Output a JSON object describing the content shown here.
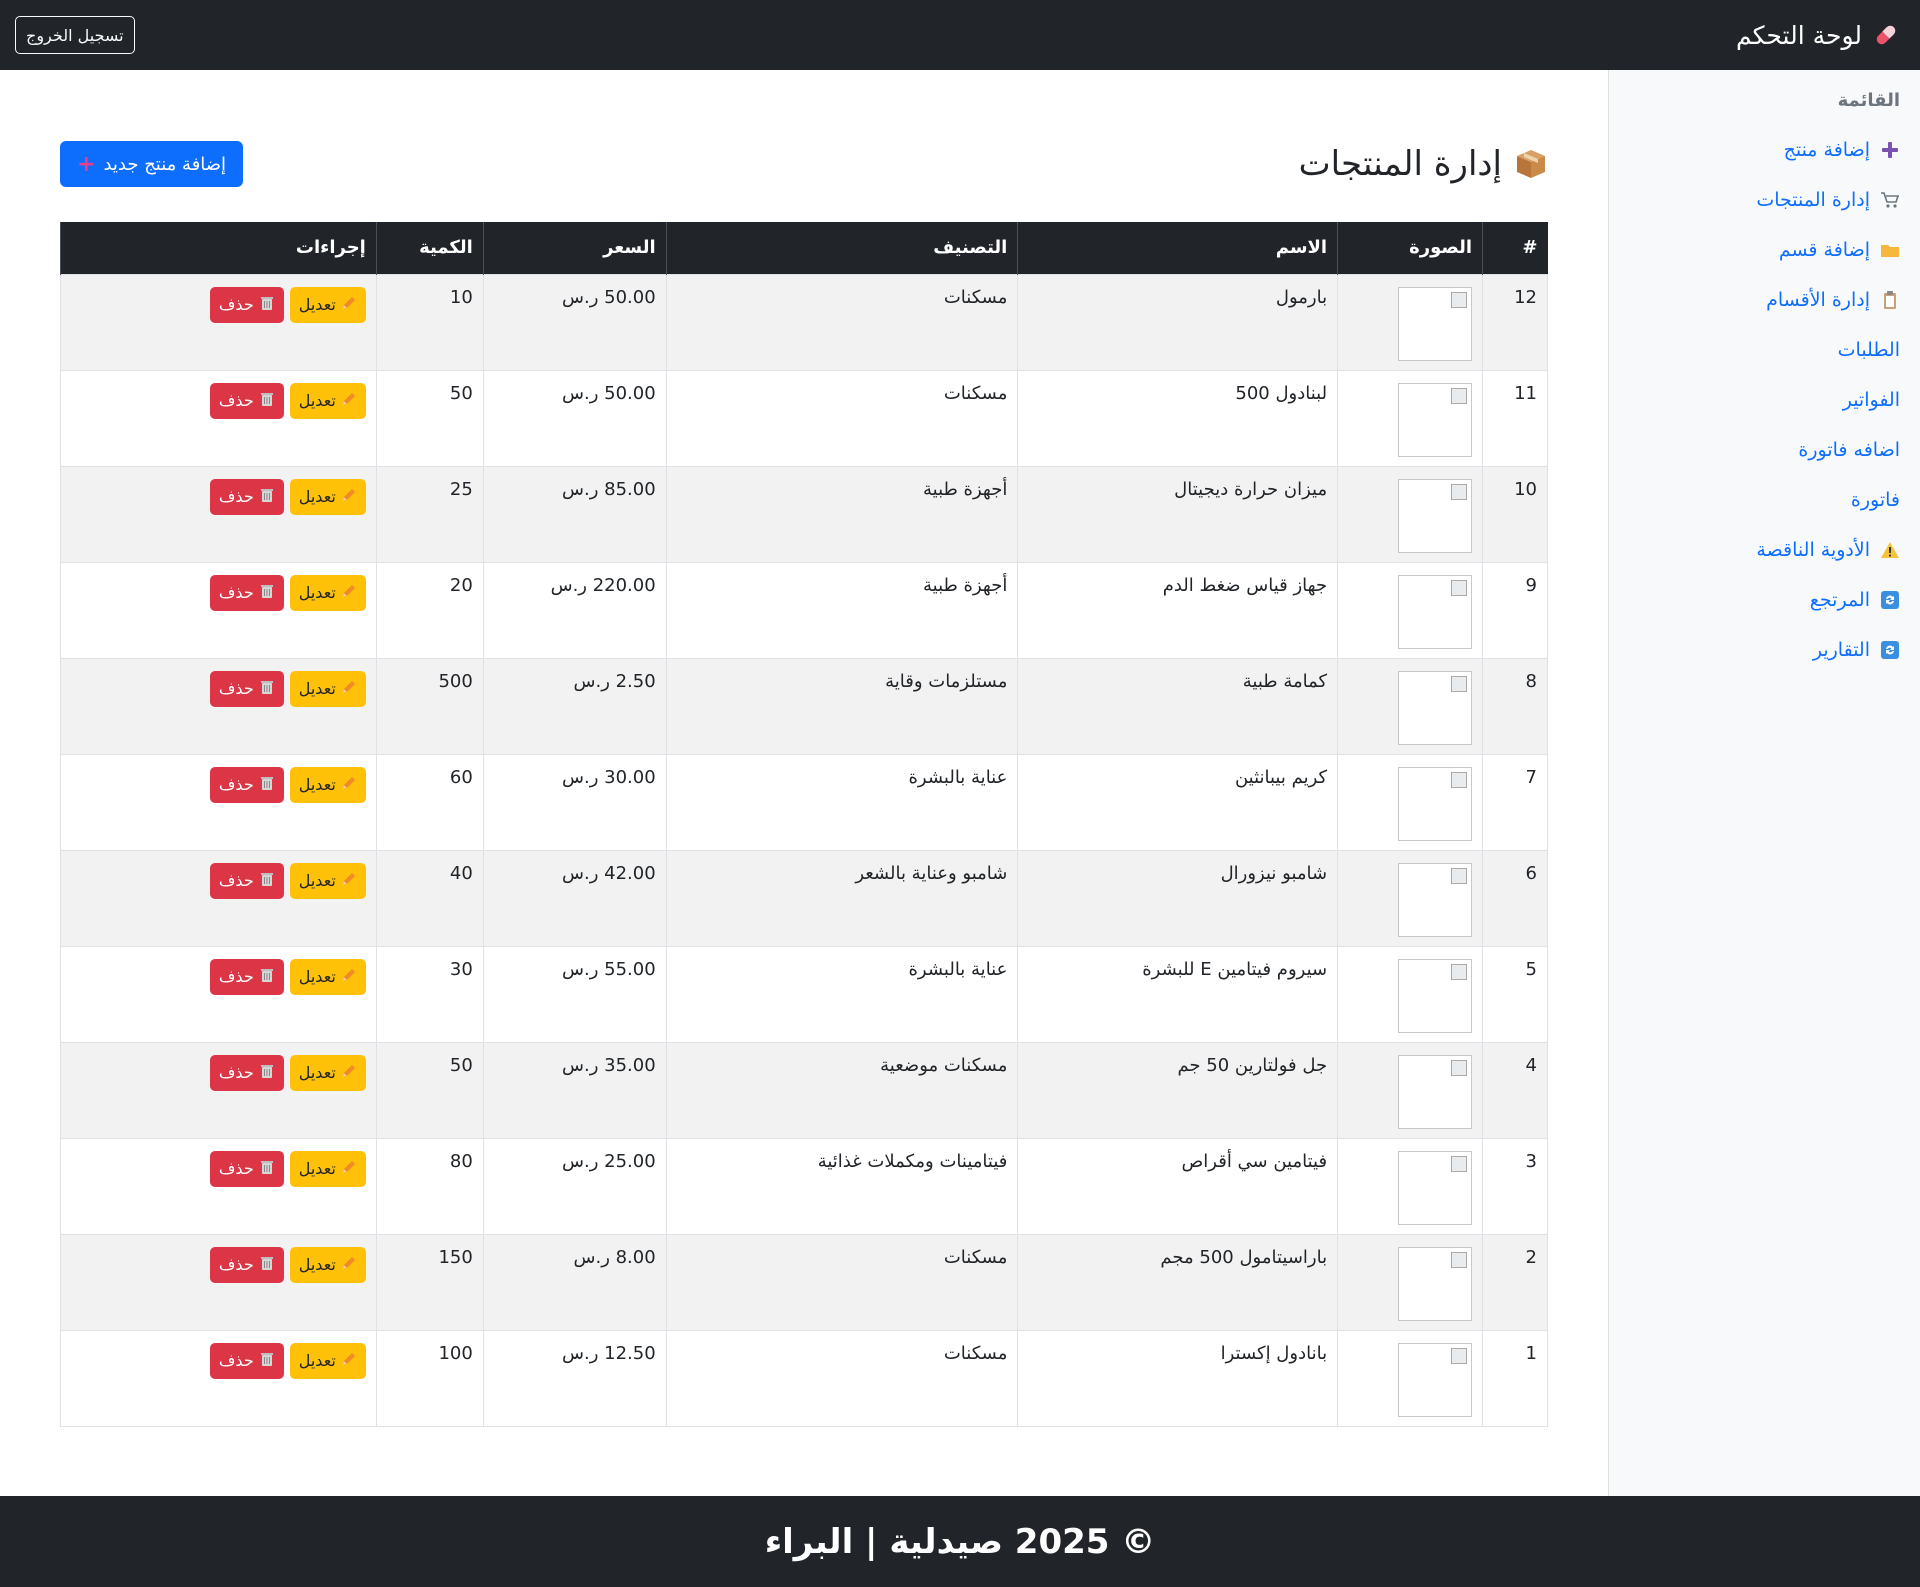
{
  "navbar": {
    "brand": "لوحة التحكم",
    "logout": "تسجيل الخروج"
  },
  "sidebar": {
    "heading": "القائمة",
    "items": [
      {
        "label": "إضافة منتج",
        "icon": "plus-icon"
      },
      {
        "label": "إدارة المنتجات",
        "icon": "cart-icon"
      },
      {
        "label": "إضافة قسم",
        "icon": "folder-icon"
      },
      {
        "label": "إدارة الأقسام",
        "icon": "clipboard-icon"
      },
      {
        "label": "الطلبات",
        "icon": ""
      },
      {
        "label": "الفواتير",
        "icon": ""
      },
      {
        "label": "اضافه فاتورة",
        "icon": ""
      },
      {
        "label": "فاتورة",
        "icon": ""
      },
      {
        "label": "الأدوية الناقصة",
        "icon": "warning-icon"
      },
      {
        "label": "المرتجع",
        "icon": "refresh-icon"
      },
      {
        "label": "التقارير",
        "icon": "refresh-icon"
      }
    ]
  },
  "main": {
    "title": "إدارة المنتجات",
    "add_button": "إضافة منتج جديد",
    "columns": [
      "#",
      "الصورة",
      "الاسم",
      "التصنيف",
      "السعر",
      "الكمية",
      "إجراءات"
    ],
    "edit_label": "تعديل",
    "delete_label": "حذف",
    "rows": [
      {
        "id": "12",
        "name": "بارمول",
        "category": "مسكنات",
        "price": "50.00 ر.س",
        "qty": "10"
      },
      {
        "id": "11",
        "name": "لبنادول 500",
        "category": "مسكنات",
        "price": "50.00 ر.س",
        "qty": "50"
      },
      {
        "id": "10",
        "name": "ميزان حرارة ديجيتال",
        "category": "أجهزة طبية",
        "price": "85.00 ر.س",
        "qty": "25"
      },
      {
        "id": "9",
        "name": "جهاز قياس ضغط الدم",
        "category": "أجهزة طبية",
        "price": "220.00 ر.س",
        "qty": "20"
      },
      {
        "id": "8",
        "name": "كمامة طبية",
        "category": "مستلزمات وقاية",
        "price": "2.50 ر.س",
        "qty": "500"
      },
      {
        "id": "7",
        "name": "كريم بيبانثين",
        "category": "عناية بالبشرة",
        "price": "30.00 ر.س",
        "qty": "60"
      },
      {
        "id": "6",
        "name": "شامبو نيزورال",
        "category": "شامبو وعناية بالشعر",
        "price": "42.00 ر.س",
        "qty": "40"
      },
      {
        "id": "5",
        "name": "سيروم فيتامين E للبشرة",
        "category": "عناية بالبشرة",
        "price": "55.00 ر.س",
        "qty": "30"
      },
      {
        "id": "4",
        "name": "جل فولتارين 50 جم",
        "category": "مسكنات موضعية",
        "price": "35.00 ر.س",
        "qty": "50"
      },
      {
        "id": "3",
        "name": "فيتامين سي أقراص",
        "category": "فيتامينات ومكملات غذائية",
        "price": "25.00 ر.س",
        "qty": "80"
      },
      {
        "id": "2",
        "name": "باراسيتامول 500 مجم",
        "category": "مسكنات",
        "price": "8.00 ر.س",
        "qty": "150"
      },
      {
        "id": "1",
        "name": "بانادول إكسترا",
        "category": "مسكنات",
        "price": "12.50 ر.س",
        "qty": "100"
      }
    ]
  },
  "footer": {
    "text": "© 2025 صيدلية | البراء"
  }
}
